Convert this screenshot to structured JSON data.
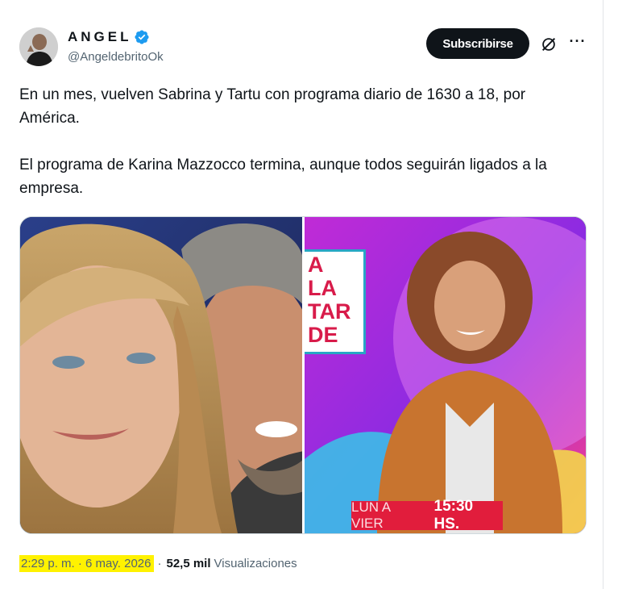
{
  "author": {
    "name": "ANGEL",
    "handle": "@AngeldebritoOk",
    "verified": true
  },
  "actions": {
    "subscribe_label": "Subscribirse",
    "grok_icon": "grok-icon",
    "more_icon": "more-options-icon",
    "more_glyph": "···"
  },
  "tweet": {
    "paragraphs": [
      "En un mes, vuelven Sabrina y Tartu con programa diario de 1630 a 18, por América.",
      "El programa de Karina Mazzocco termina, aunque todos seguirán ligados a la empresa."
    ]
  },
  "media": {
    "left_image": "photo-woman-and-man",
    "right_image": "photo-woman-promo",
    "promo_sign_lines": [
      "A",
      "LA",
      "TAR",
      "DE"
    ],
    "schedule_days": "LUN A VIER",
    "schedule_time": "15:30 HS."
  },
  "meta": {
    "time": "2:29 p. m. · 6 may. 2026",
    "separator": "·",
    "views_count": "52,5 mil",
    "views_label": "Visualizaciones"
  },
  "colors": {
    "subscribe_bg": "#0f1419",
    "verified": "#1d9bf0",
    "secondary_text": "#536471",
    "highlight": "#fff200",
    "promo_red": "#e11d3c"
  }
}
